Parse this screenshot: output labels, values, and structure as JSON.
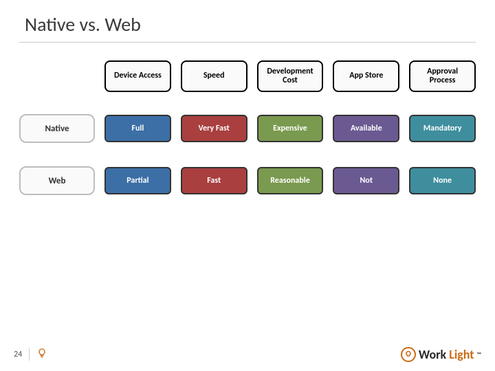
{
  "slide": {
    "title": "Native vs. Web",
    "page_number": "24"
  },
  "colors": {
    "blue": "#3c6fa6",
    "red": "#aa3f3f",
    "green": "#7a9a4f",
    "purple": "#6b5a92",
    "teal": "#3f8e9e"
  },
  "columns": [
    "Device Access",
    "Speed",
    "Development Cost",
    "App Store",
    "Approval Process"
  ],
  "rows": [
    {
      "label": "Native",
      "cells": [
        "Full",
        "Very Fast",
        "Expensive",
        "Available",
        "Mandatory"
      ]
    },
    {
      "label": "Web",
      "cells": [
        "Partial",
        "Fast",
        "Reasonable",
        "Not",
        "None"
      ]
    }
  ],
  "brand": {
    "work": "Work",
    "light": "Light",
    "tm": "™"
  },
  "chart_data": {
    "type": "table",
    "title": "Native vs. Web",
    "columns": [
      "Device Access",
      "Speed",
      "Development Cost",
      "App Store",
      "Approval Process"
    ],
    "rows": [
      {
        "name": "Native",
        "values": [
          "Full",
          "Very Fast",
          "Expensive",
          "Available",
          "Mandatory"
        ]
      },
      {
        "name": "Web",
        "values": [
          "Partial",
          "Fast",
          "Reasonable",
          "Not",
          "None"
        ]
      }
    ]
  }
}
